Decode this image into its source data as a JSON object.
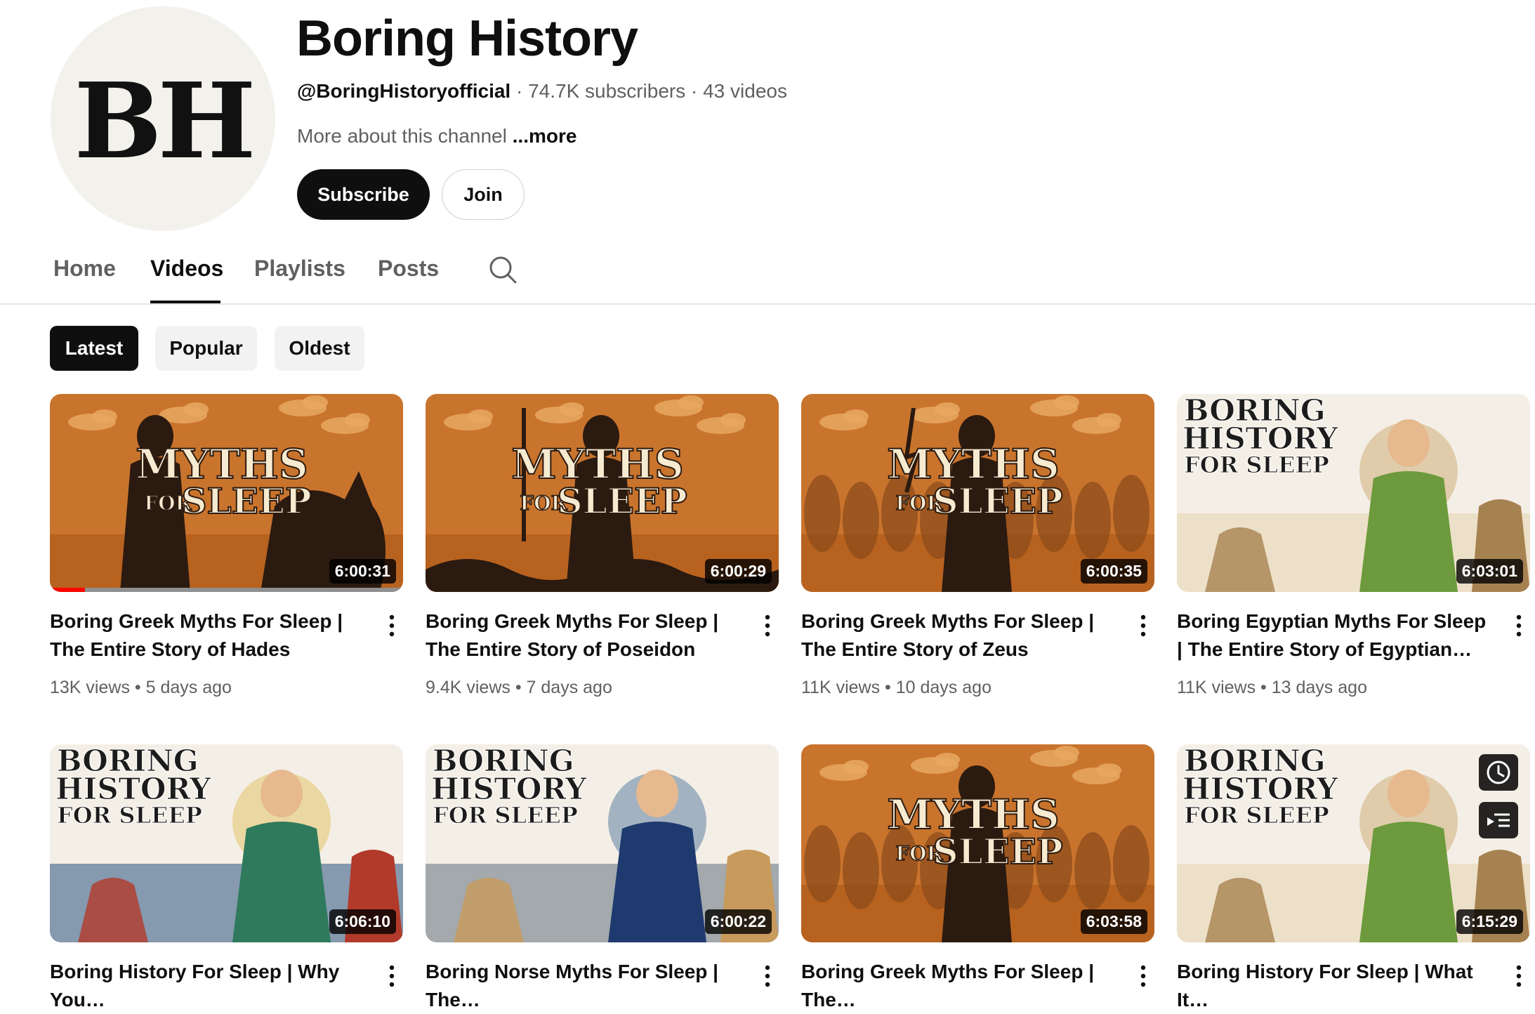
{
  "channel": {
    "avatar_text": "BH",
    "name": "Boring History",
    "handle": "@BoringHistoryofficial",
    "subscribers": "74.7K subscribers",
    "video_count": "43 videos",
    "about": "More about this channel",
    "more_link": "...more",
    "subscribe_label": "Subscribe",
    "join_label": "Join"
  },
  "tabs": [
    {
      "label": "Home"
    },
    {
      "label": "Videos"
    },
    {
      "label": "Playlists"
    },
    {
      "label": "Posts"
    }
  ],
  "chips": [
    {
      "label": "Latest"
    },
    {
      "label": "Popular"
    },
    {
      "label": "Oldest"
    }
  ],
  "videos": [
    {
      "title": "Boring Greek Myths For Sleep | The Entire Story of Hades",
      "views": "13K views",
      "age": "5 days ago",
      "duration": "6:00:31",
      "watched_fraction": 0.1,
      "thumb_logo": "MYTHS FOR SLEEP",
      "thumb_lines": [
        "MYTHS",
        "FOR",
        "SLEEP"
      ]
    },
    {
      "title": "Boring Greek Myths For Sleep | The Entire Story of Poseidon",
      "views": "9.4K views",
      "age": "7 days ago",
      "duration": "6:00:29",
      "thumb_logo": "MYTHS FOR SLEEP",
      "thumb_lines": [
        "MYTHS",
        "FOR",
        "SLEEP"
      ]
    },
    {
      "title": "Boring Greek Myths For Sleep | The Entire Story of Zeus",
      "views": "11K views",
      "age": "10 days ago",
      "duration": "6:00:35",
      "thumb_logo": "MYTHS FOR SLEEP",
      "thumb_lines": [
        "MYTHS",
        "FOR",
        "SLEEP"
      ]
    },
    {
      "title": "Boring Egyptian Myths For Sleep | The Entire Story of Egyptian…",
      "views": "11K views",
      "age": "13 days ago",
      "duration": "6:03:01",
      "thumb_logo": "BORING HISTORY FOR SLEEP",
      "thumb_lines": [
        "BORING",
        "HISTORY",
        "FOR SLEEP"
      ]
    },
    {
      "title": "Boring History For Sleep | Why You…",
      "duration": "6:06:10",
      "thumb_logo": "BORING HISTORY FOR SLEEP",
      "thumb_lines": [
        "BORING",
        "HISTORY",
        "FOR SLEEP"
      ]
    },
    {
      "title": "Boring Norse Myths For Sleep | The…",
      "duration": "6:00:22",
      "thumb_logo": "BORING HISTORY FOR SLEEP",
      "thumb_lines": [
        "BORING",
        "HISTORY",
        "FOR SLEEP"
      ]
    },
    {
      "title": "Boring Greek Myths For Sleep | The…",
      "duration": "6:03:58",
      "thumb_logo": "MYTHS FOR SLEEP",
      "thumb_lines": [
        "MYTHS",
        "FOR",
        "SLEEP"
      ]
    },
    {
      "title": "Boring History For Sleep | What It…",
      "duration": "6:15:29",
      "thumb_logo": "BORING HISTORY FOR SLEEP",
      "thumb_lines": [
        "BORING",
        "HISTORY",
        "FOR SLEEP"
      ]
    }
  ],
  "hover_actions": [
    {
      "icon": "clock-icon"
    },
    {
      "icon": "add-to-queue-icon"
    }
  ],
  "colors": {
    "accent": "#0f0f0f",
    "progress": "#ff0000",
    "myths_bg": "#c9742d",
    "myths_dark": "#2b1a10",
    "history_bg": "#f4efe6"
  }
}
